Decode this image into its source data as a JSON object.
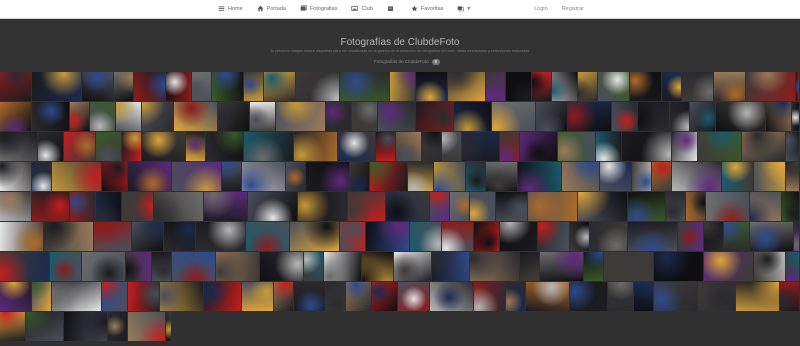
{
  "nav": {
    "items": [
      {
        "label": "Home",
        "icon": "home-dash-icon",
        "name": "nav-home"
      },
      {
        "label": "Portada",
        "icon": "house-icon",
        "name": "nav-portada"
      },
      {
        "label": "Fotografias",
        "icon": "photo-stack-icon",
        "name": "nav-fotografias"
      },
      {
        "label": "Club",
        "icon": "picture-icon",
        "name": "nav-club"
      },
      {
        "label": "",
        "icon": "archive-icon",
        "name": "nav-archive"
      },
      {
        "label": "Favoritas",
        "icon": "star-icon",
        "name": "nav-favoritas"
      },
      {
        "label": "▾",
        "icon": "gallery-dropdown-icon",
        "name": "nav-gallery-menu"
      }
    ],
    "login": "Login",
    "register": "Registrar"
  },
  "header": {
    "title": "Fotografías de ClubdeFoto",
    "subtitle": "la presente imagen estará dispuesta para ser visualizada en la galería de la selección de fotografías del club, obras destacadas y selecciones realizadas",
    "category_label": "Fotografías de ClubdeFoto",
    "count_badge": "8"
  },
  "colors": {
    "background": "#2b2b2b",
    "nav_bg": "#ffffff",
    "palette": [
      "#0f0f12",
      "#1b1b20",
      "#2a2a2f",
      "#3d3a37",
      "#4a4f5a",
      "#b8b8b8",
      "#e6e6e6",
      "#c69a3b",
      "#e0a63d",
      "#c41e1e",
      "#8b1d1d",
      "#1b2a4e",
      "#2f4a8c",
      "#5d2a7a",
      "#3a5a2a",
      "#1b5a6a",
      "#ad6a2a",
      "#6d6d6d",
      "#9a7a5a"
    ]
  }
}
